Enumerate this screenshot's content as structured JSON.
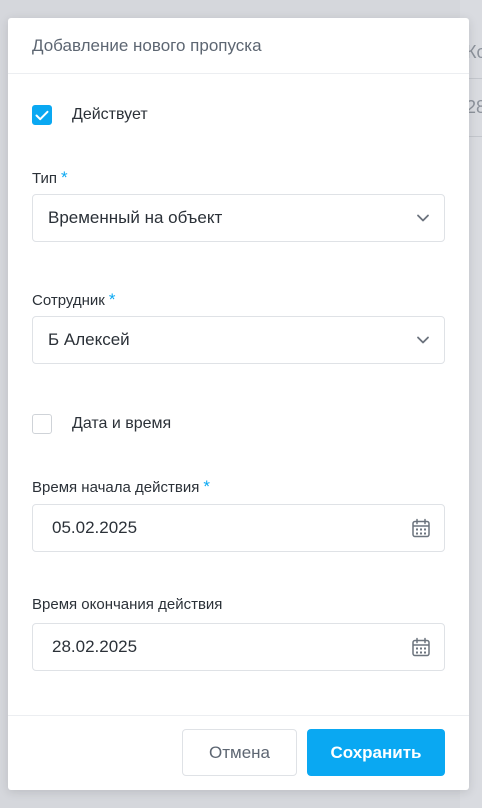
{
  "background": {
    "peek_top": "Ко",
    "peek_bottom": "28"
  },
  "dialog": {
    "title": "Добавление нового пропуска",
    "active": {
      "label": "Действует",
      "checked": true
    },
    "type_field": {
      "label": "Тип",
      "required": "*",
      "value": "Временный на объект"
    },
    "employee_field": {
      "label": "Сотрудник",
      "required": "*",
      "value": "Б Алексей"
    },
    "datetime": {
      "label": "Дата и время",
      "checked": false
    },
    "start_field": {
      "label": "Время начала действия",
      "required": "*",
      "value": "05.02.2025"
    },
    "end_field": {
      "label": "Время окончания действия",
      "value": "28.02.2025"
    },
    "buttons": {
      "cancel": "Отмена",
      "save": "Сохранить"
    }
  },
  "colors": {
    "accent": "#0aa8f2",
    "border": "#dfe2e6",
    "text": "#2b3138",
    "muted": "#5d6672"
  },
  "icons": {
    "checkbox": "check-icon",
    "select": "chevron-down-icon",
    "date": "calendar-icon"
  }
}
